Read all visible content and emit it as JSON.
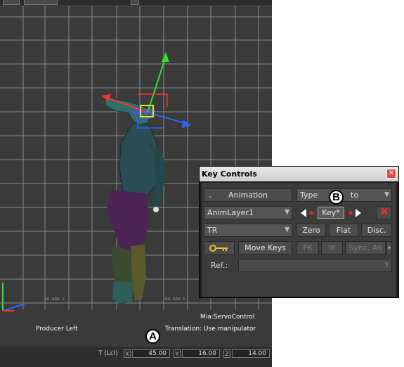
{
  "viewport": {
    "view_name": "Producer Left",
    "status_line1": "Mia:ServoControl",
    "status_line2": "Translation: Use manipulator",
    "grid_tick_1": "68.888 S",
    "grid_tick_2": "68.888 S",
    "colors": {
      "background": "#3a3a3a",
      "grid": "#8a8a8a",
      "axis_x": "#ff3030",
      "axis_y": "#30e030",
      "axis_z": "#3060ff"
    }
  },
  "statusbar": {
    "t_label": "T (Lcl)",
    "x_axis": "X",
    "x_value": "45.00",
    "y_axis": "Y",
    "y_value": "16.00",
    "z_axis": "Z",
    "z_value": "14.00"
  },
  "callouts": {
    "a": "A",
    "b": "B"
  },
  "key_controls": {
    "title": "Key Controls",
    "close_icon": "close-x-icon",
    "mode_button": "Animation",
    "type_dropdown": "Type",
    "type_dropdown_tail": "to",
    "layer_dropdown": "AnimLayer1",
    "key_button": "Key*",
    "channel_dropdown": "TR",
    "zero_button": "Zero",
    "flat_button": "Flat",
    "disc_button": "Disc.",
    "move_keys_button": "Move Keys",
    "fk_button": "FK",
    "ik_button": "IK",
    "sync_all_button": "Sync. All",
    "ref_label": "Ref.:",
    "ref_dropdown": ""
  }
}
